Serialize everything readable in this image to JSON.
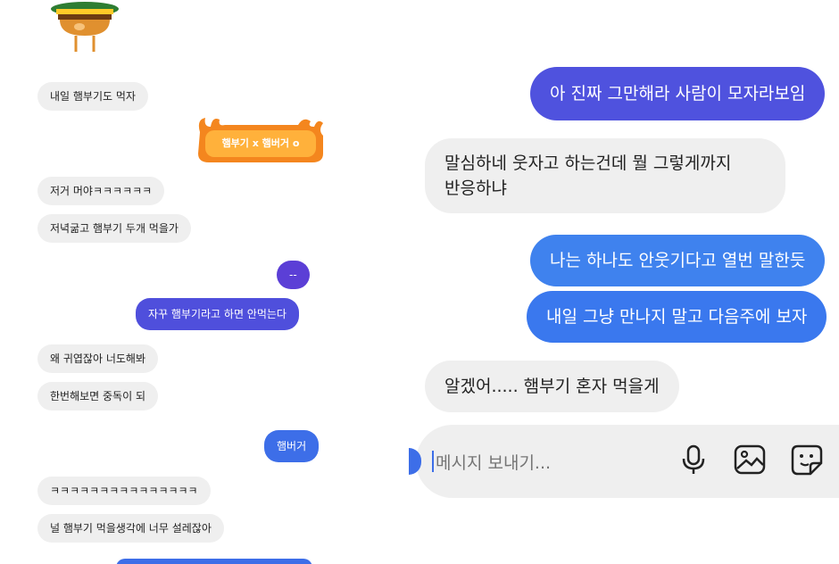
{
  "left_chat": {
    "messages": [
      {
        "side": "in",
        "text": "내일 햄부기도 먹자"
      },
      {
        "side": "out_sticker",
        "text": "햄부기 x 햄버거 o"
      },
      {
        "side": "in",
        "text": "저거 머야ㅋㅋㅋㅋㅋㅋ"
      },
      {
        "side": "in",
        "text": "저녁굶고 햄부기 두개 먹을가"
      },
      {
        "side": "out",
        "text": "--"
      },
      {
        "side": "out",
        "text": "자꾸 햄부기라고 하면 안먹는다"
      },
      {
        "side": "in",
        "text": "왜 귀엽잖아 너도해봐"
      },
      {
        "side": "in",
        "text": "한번해보면 중독이 되"
      },
      {
        "side": "out",
        "text": "햄버거"
      },
      {
        "side": "in",
        "text": "ㅋㅋㅋㅋㅋㅋㅋㅋㅋㅋㅋㅋㅋㅋㅋ"
      },
      {
        "side": "in",
        "text": "널 햄부기 먹을생각에 너무 설레잖아"
      }
    ]
  },
  "right_chat": {
    "messages": [
      {
        "side": "out",
        "text": "아 진짜 그만해라 사람이 모자라보임"
      },
      {
        "side": "in",
        "lines": [
          "말심하네 웃자고 하는건데 뭘 그렇게까지",
          "반응하냐"
        ]
      },
      {
        "side": "out",
        "text": "나는 하나도 안웃기다고 열번 말한듯"
      },
      {
        "side": "out",
        "text": "내일 그냥 만나지 말고 다음주에 보자"
      },
      {
        "side": "in",
        "text": "알겠어..... 햄부기 혼자 먹을게"
      }
    ]
  },
  "composer": {
    "placeholder": "메시지 보내기...",
    "icons": [
      "microphone-icon",
      "image-icon",
      "sticker-icon"
    ]
  },
  "colors": {
    "bubble_in": "#efefef",
    "purple": "#5b3fd6",
    "blue": "#3d6ee8",
    "sticker_orange": "#f4861e"
  }
}
